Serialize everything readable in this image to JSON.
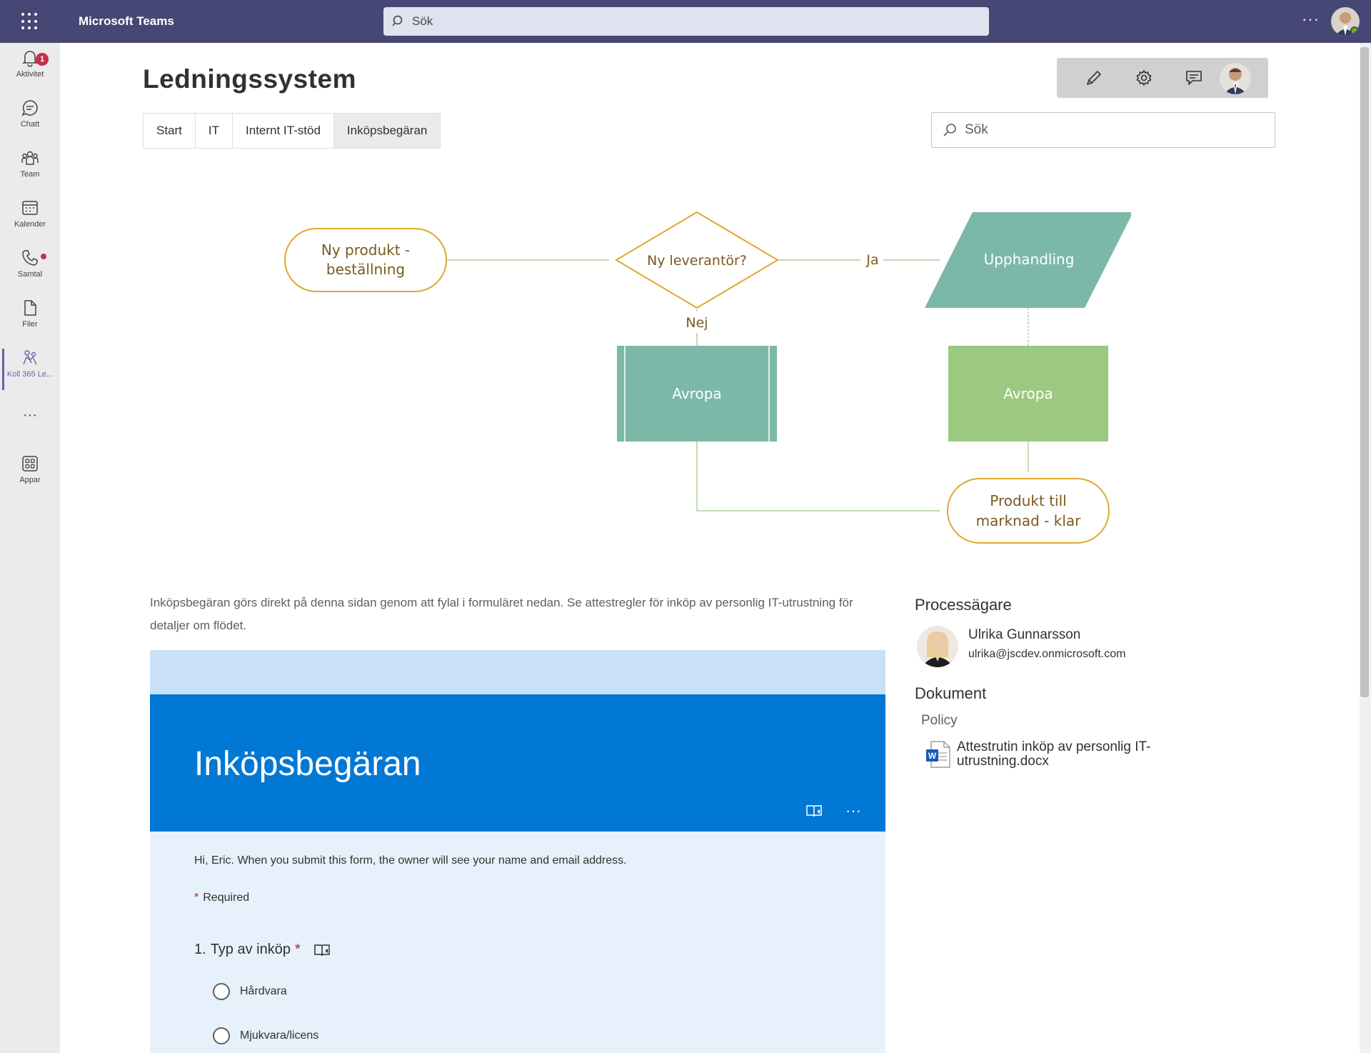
{
  "app": {
    "title": "Microsoft Teams",
    "search_placeholder": "Sök",
    "more": "···"
  },
  "rail": {
    "items": [
      {
        "label": "Aktivitet",
        "icon": "bell-icon",
        "badge": "1"
      },
      {
        "label": "Chatt",
        "icon": "chat-icon"
      },
      {
        "label": "Team",
        "icon": "teams-icon"
      },
      {
        "label": "Kalender",
        "icon": "calendar-icon"
      },
      {
        "label": "Samtal",
        "icon": "phone-icon"
      },
      {
        "label": "Filer",
        "icon": "file-icon"
      },
      {
        "label": "Koll 365 Le...",
        "icon": "koll365-app-icon",
        "active": true
      },
      {
        "label": "···",
        "icon": "more-icon"
      },
      {
        "label": "Appar",
        "icon": "apps-icon"
      }
    ]
  },
  "page": {
    "title": "Ledningssystem",
    "breadcrumb": [
      "Start",
      "IT",
      "Internt IT-stöd",
      "Inköpsbegäran"
    ],
    "search_placeholder": "Sök"
  },
  "flowchart": {
    "nodes": {
      "start": "Ny produkt - beställning",
      "decision": "Ny leverantör?",
      "procurement": "Upphandling",
      "avropa_left": "Avropa",
      "avropa_right": "Avropa",
      "end": "Produkt till marknad - klar"
    },
    "edge_labels": {
      "yes": "Ja",
      "no": "Nej"
    },
    "colors": {
      "terminator_border": "#e0a82e",
      "teal": "#7cb8a8",
      "green": "#9bc97f",
      "text": "#7a5a20",
      "line": "#a9cf96"
    }
  },
  "intro": "Inköpsbegäran görs direkt på denna sidan genom att fylal i formuläret nedan. Se attestregler för inköp av personlig IT-utrustning för detaljer om flödet.",
  "form": {
    "title": "Inköpsbegäran",
    "notice": "Hi, Eric. When you submit this form, the owner will see your name and email address.",
    "required_label": "Required",
    "question1": {
      "number": "1.",
      "text": "Typ av inköp",
      "options": [
        "Hårdvara",
        "Mjukvara/licens"
      ]
    },
    "more": "···",
    "accent": "#0078d4"
  },
  "owner": {
    "heading": "Processägare",
    "name": "Ulrika Gunnarsson",
    "email": "ulrika@jscdev.onmicrosoft.com"
  },
  "documents": {
    "heading": "Dokument",
    "category": "Policy",
    "file": "Attestrutin inköp av personlig IT-utrustning.docx",
    "file_icon": "word-doc-icon"
  }
}
